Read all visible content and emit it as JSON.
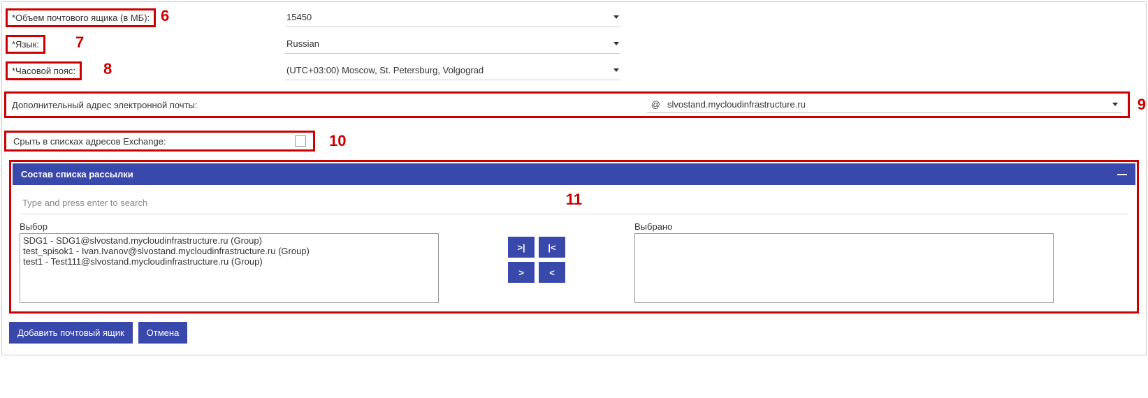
{
  "annotations": {
    "n6": "6",
    "n7": "7",
    "n8": "8",
    "n9": "9",
    "n10": "10",
    "n11": "11"
  },
  "fields": {
    "mailbox_size": {
      "label": "*Объем почтового ящика (в МБ):",
      "value": "15450"
    },
    "language": {
      "label": "*Язык:",
      "value": "Russian"
    },
    "timezone": {
      "label": "*Часовой пояс:",
      "value": "(UTC+03:00) Moscow, St. Petersburg, Volgograd"
    },
    "additional_email": {
      "label": "Дополнительный адрес электронной почты:",
      "at": "@",
      "domain": "slvostand.mycloudinfrastructure.ru"
    },
    "hide_exchange": {
      "label": "Срыть в списках адресов Exchange:"
    }
  },
  "panel": {
    "title": "Состав списка рассылки",
    "search_placeholder": "Type and press enter to search",
    "picker": {
      "left_label": "Выбор",
      "right_label": "Выбрано",
      "left_items": [
        "SDG1 - SDG1@slvostand.mycloudinfrastructure.ru (Group)",
        "test_spisok1 - Ivan.Ivanov@slvostand.mycloudinfrastructure.ru (Group)",
        "test1 - Test111@slvostand.mycloudinfrastructure.ru (Group)"
      ]
    },
    "buttons": {
      "move_all_right": ">|",
      "move_all_left": "|<",
      "move_right": ">",
      "move_left": "<"
    }
  },
  "footer": {
    "add": "Добавить почтовый ящик",
    "cancel": "Отмена"
  }
}
